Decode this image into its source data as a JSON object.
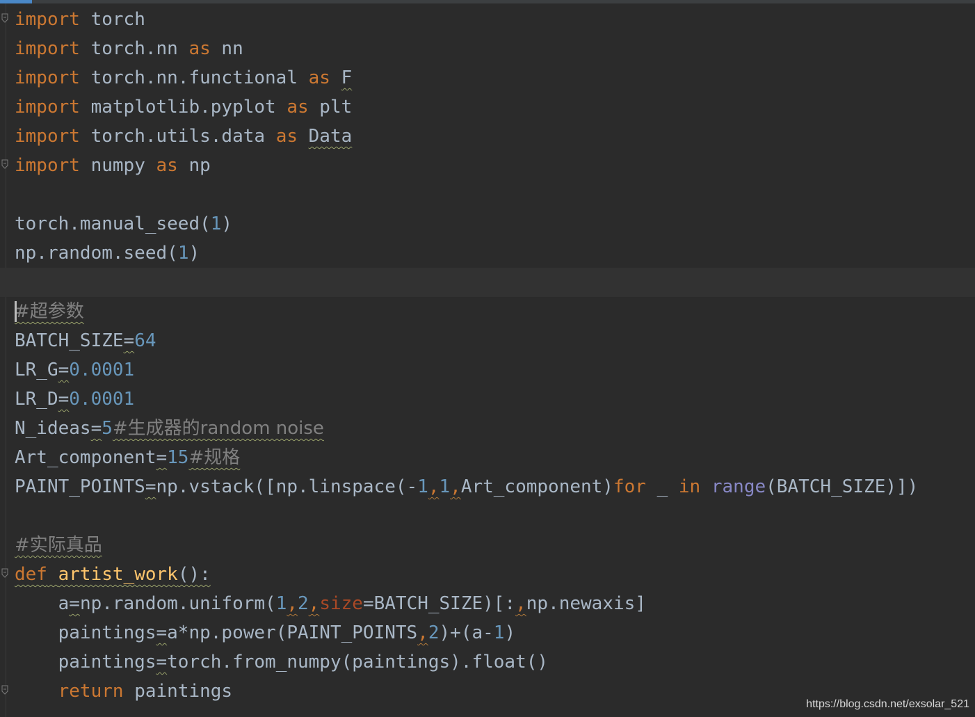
{
  "editor": {
    "language": "python",
    "colors": {
      "background": "#2b2b2b",
      "keyword": "#cc7832",
      "number": "#6897bb",
      "function_def": "#ffc66d",
      "builtin": "#8888c6",
      "comment": "#808080",
      "parameter": "#aa4926",
      "plain": "#a9b7c6"
    },
    "cursor_line": 10,
    "lines": [
      [
        {
          "t": "import",
          "k": "kw"
        },
        {
          "t": " torch",
          "k": "pl"
        }
      ],
      [
        {
          "t": "import",
          "k": "kw"
        },
        {
          "t": " torch.nn ",
          "k": "pl"
        },
        {
          "t": "as",
          "k": "kw"
        },
        {
          "t": " nn",
          "k": "pl"
        }
      ],
      [
        {
          "t": "import",
          "k": "kw"
        },
        {
          "t": " torch.nn.functional ",
          "k": "pl"
        },
        {
          "t": "as",
          "k": "kw"
        },
        {
          "t": " ",
          "k": "pl"
        },
        {
          "t": "F",
          "k": "pl",
          "s": 1
        }
      ],
      [
        {
          "t": "import",
          "k": "kw"
        },
        {
          "t": " matplotlib.pyplot ",
          "k": "pl"
        },
        {
          "t": "as",
          "k": "kw"
        },
        {
          "t": " plt",
          "k": "pl"
        }
      ],
      [
        {
          "t": "import",
          "k": "kw"
        },
        {
          "t": " torch.utils.data ",
          "k": "pl"
        },
        {
          "t": "as",
          "k": "kw"
        },
        {
          "t": " ",
          "k": "pl"
        },
        {
          "t": "Data",
          "k": "pl",
          "s": 1
        }
      ],
      [
        {
          "t": "import",
          "k": "kw"
        },
        {
          "t": " numpy ",
          "k": "pl"
        },
        {
          "t": "as",
          "k": "kw"
        },
        {
          "t": " np",
          "k": "pl"
        }
      ],
      [],
      [
        {
          "t": "torch.manual_seed(",
          "k": "pl"
        },
        {
          "t": "1",
          "k": "num"
        },
        {
          "t": ")",
          "k": "pl"
        }
      ],
      [
        {
          "t": "np.random.seed(",
          "k": "pl"
        },
        {
          "t": "1",
          "k": "num"
        },
        {
          "t": ")",
          "k": "pl"
        }
      ],
      [],
      [
        {
          "t": "#超参数",
          "k": "cm",
          "s": 1
        }
      ],
      [
        {
          "t": "BATCH_SIZE",
          "k": "pl"
        },
        {
          "t": "=",
          "k": "pl",
          "s": 1
        },
        {
          "t": "64",
          "k": "num"
        }
      ],
      [
        {
          "t": "LR_G",
          "k": "pl"
        },
        {
          "t": "=",
          "k": "pl",
          "s": 1
        },
        {
          "t": "0.0001",
          "k": "num"
        }
      ],
      [
        {
          "t": "LR_D",
          "k": "pl"
        },
        {
          "t": "=",
          "k": "pl",
          "s": 1
        },
        {
          "t": "0.0001",
          "k": "num"
        }
      ],
      [
        {
          "t": "N_ideas",
          "k": "pl"
        },
        {
          "t": "=",
          "k": "pl",
          "s": 1
        },
        {
          "t": "5",
          "k": "num"
        },
        {
          "t": "#生成器的random noise",
          "k": "cm",
          "s": 1
        }
      ],
      [
        {
          "t": "Art_component",
          "k": "pl"
        },
        {
          "t": "=",
          "k": "pl",
          "s": 1
        },
        {
          "t": "15",
          "k": "num"
        },
        {
          "t": "#规格",
          "k": "cm",
          "s": 1
        }
      ],
      [
        {
          "t": "PAINT_POINTS",
          "k": "pl"
        },
        {
          "t": "=",
          "k": "pl",
          "s": 1
        },
        {
          "t": "np.vstack([np.linspace(-",
          "k": "pl"
        },
        {
          "t": "1",
          "k": "num"
        },
        {
          "t": ",",
          "k": "kw",
          "s": 2
        },
        {
          "t": "1",
          "k": "num"
        },
        {
          "t": ",",
          "k": "kw",
          "s": 2
        },
        {
          "t": "Art_component)",
          "k": "pl"
        },
        {
          "t": "for",
          "k": "kw"
        },
        {
          "t": " _ ",
          "k": "pl"
        },
        {
          "t": "in",
          "k": "kw"
        },
        {
          "t": " ",
          "k": "pl"
        },
        {
          "t": "range",
          "k": "bi"
        },
        {
          "t": "(BATCH_SIZE)])",
          "k": "pl"
        }
      ],
      [],
      [
        {
          "t": "#实际真品",
          "k": "cm",
          "s": 1
        }
      ],
      [
        {
          "t": "def",
          "k": "kw",
          "s": 1
        },
        {
          "t": " ",
          "k": "pl",
          "s": 1
        },
        {
          "t": "artist_work",
          "k": "fn",
          "s": 1
        },
        {
          "t": "():",
          "k": "pl",
          "s": 1
        }
      ],
      [
        {
          "t": "    a",
          "k": "pl"
        },
        {
          "t": "=",
          "k": "pl",
          "s": 1
        },
        {
          "t": "np.random.uniform(",
          "k": "pl"
        },
        {
          "t": "1",
          "k": "num"
        },
        {
          "t": ",",
          "k": "kw",
          "s": 2
        },
        {
          "t": "2",
          "k": "num"
        },
        {
          "t": ",",
          "k": "kw",
          "s": 2
        },
        {
          "t": "size",
          "k": "par"
        },
        {
          "t": "=BATCH_SIZE)[:",
          "k": "pl"
        },
        {
          "t": ",",
          "k": "kw",
          "s": 2
        },
        {
          "t": "np.newaxis]",
          "k": "pl"
        }
      ],
      [
        {
          "t": "    paintings",
          "k": "pl"
        },
        {
          "t": "=",
          "k": "pl",
          "s": 1
        },
        {
          "t": "a*np.power(PAINT_POINTS",
          "k": "pl"
        },
        {
          "t": ",",
          "k": "kw",
          "s": 2
        },
        {
          "t": "2",
          "k": "num"
        },
        {
          "t": ")+(a-",
          "k": "pl"
        },
        {
          "t": "1",
          "k": "num"
        },
        {
          "t": ")",
          "k": "pl"
        }
      ],
      [
        {
          "t": "    paintings",
          "k": "pl"
        },
        {
          "t": "=",
          "k": "pl",
          "s": 1
        },
        {
          "t": "torch.from_numpy(paintings).float()",
          "k": "pl"
        }
      ],
      [
        {
          "t": "    ",
          "k": "pl"
        },
        {
          "t": "return",
          "k": "kw"
        },
        {
          "t": " paintings",
          "k": "pl"
        }
      ]
    ],
    "fold_marks": [
      0,
      5,
      19,
      23
    ]
  },
  "watermark": {
    "text": "https://blog.csdn.net/exsolar_521"
  }
}
